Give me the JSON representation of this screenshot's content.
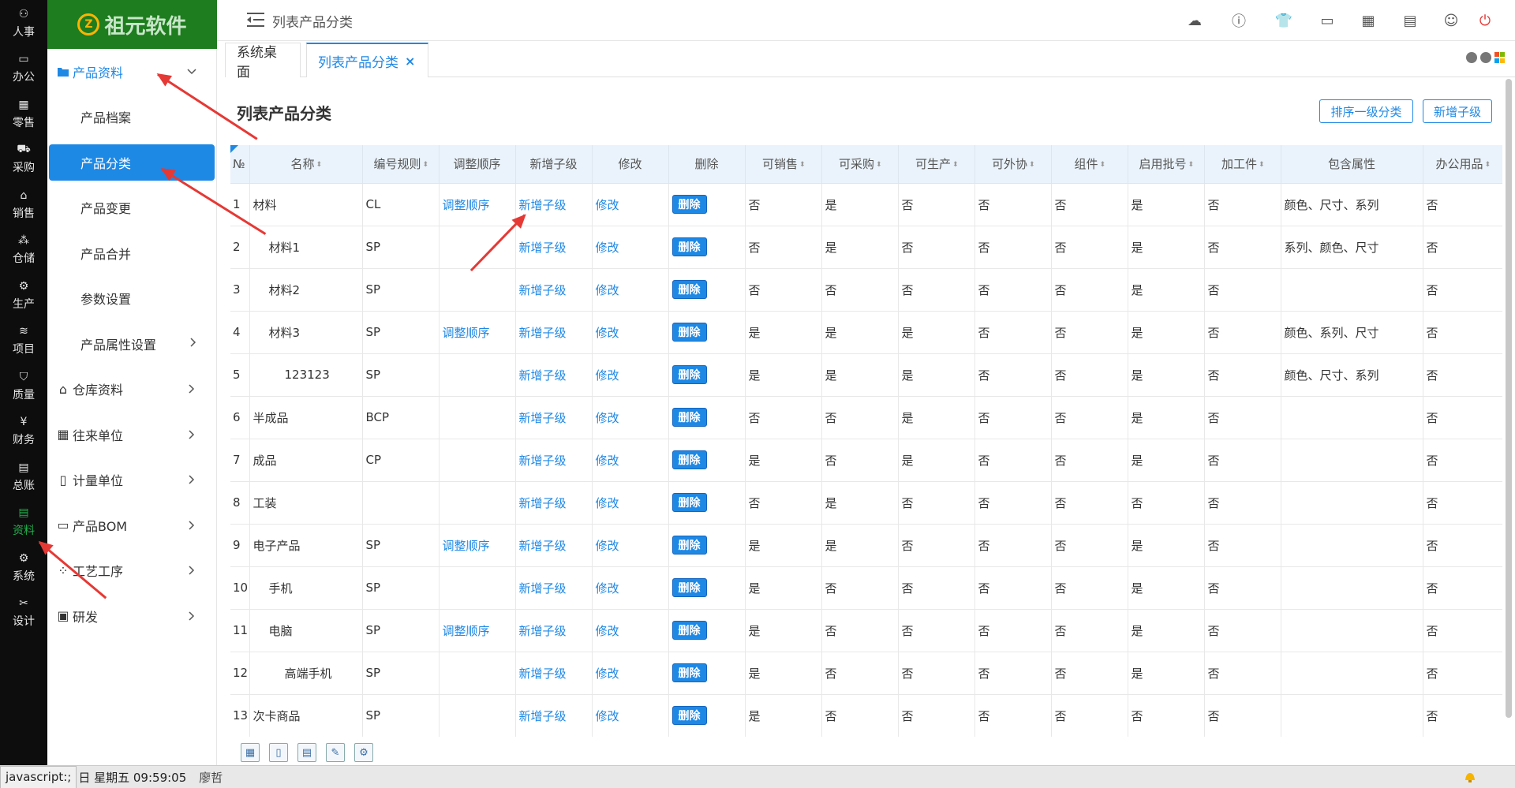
{
  "app": {
    "logo_text": "祖元软件",
    "rail": [
      {
        "label": "人事",
        "icon": "people-icon"
      },
      {
        "label": "办公",
        "icon": "monitor-icon"
      },
      {
        "label": "零售",
        "icon": "store-icon"
      },
      {
        "label": "采购",
        "icon": "truck-icon"
      },
      {
        "label": "销售",
        "icon": "shop-icon"
      },
      {
        "label": "仓储",
        "icon": "boxes-icon"
      },
      {
        "label": "生产",
        "icon": "factory-icon"
      },
      {
        "label": "项目",
        "icon": "layers-icon"
      },
      {
        "label": "质量",
        "icon": "shield-icon"
      },
      {
        "label": "财务",
        "icon": "yen-icon"
      },
      {
        "label": "总账",
        "icon": "ledger-icon"
      },
      {
        "label": "资料",
        "icon": "document-icon"
      },
      {
        "label": "系统",
        "icon": "gear-icon"
      },
      {
        "label": "设计",
        "icon": "tools-icon"
      }
    ],
    "rail_active_index": 11
  },
  "sidebar": {
    "group_open": {
      "label": "产品资料",
      "icon": "folder-icon"
    },
    "sub_items": [
      "产品档案",
      "产品分类",
      "产品变更",
      "产品合并",
      "参数设置",
      "产品属性设置"
    ],
    "active_sub_index": 1,
    "groups": [
      {
        "label": "仓库资料",
        "icon": "warehouse-icon"
      },
      {
        "label": "往来单位",
        "icon": "building-icon"
      },
      {
        "label": "计量单位",
        "icon": "ruler-icon"
      },
      {
        "label": "产品BOM",
        "icon": "bom-icon"
      },
      {
        "label": "工艺工序",
        "icon": "process-icon"
      },
      {
        "label": "研发",
        "icon": "research-icon"
      }
    ]
  },
  "topbar": {
    "crumb": "列表产品分类",
    "icons": [
      "cloud-icon",
      "help-icon",
      "shirt-icon",
      "window-icon",
      "apps-icon",
      "calendar-icon",
      "user-card-icon",
      "power-icon"
    ]
  },
  "tabs": [
    {
      "label": "系统桌面"
    },
    {
      "label": "列表产品分类",
      "close": "×"
    }
  ],
  "page": {
    "title": "列表产品分类",
    "sort_button": "排序一级分类",
    "add_child_button": "新增子级"
  },
  "table": {
    "headers": [
      "№",
      "名称",
      "编号规则",
      "调整顺序",
      "新增子级",
      "修改",
      "删除",
      "可销售",
      "可采购",
      "可生产",
      "可外协",
      "组件",
      "启用批号",
      "加工件",
      "包含属性",
      "办公用品"
    ],
    "sortable": [
      false,
      true,
      true,
      false,
      false,
      false,
      false,
      true,
      true,
      true,
      true,
      true,
      true,
      true,
      false,
      true
    ],
    "rows": [
      {
        "no": "1",
        "name": "材料",
        "indent": 0,
        "code": "CL",
        "adjust": "调整顺序",
        "add": "新增子级",
        "edit": "修改",
        "del": "删除",
        "sale": "否",
        "purchase": "是",
        "produce": "否",
        "outsource": "否",
        "component": "否",
        "batch": "是",
        "processed": "否",
        "attrs": "颜色、尺寸、系列",
        "office": "否"
      },
      {
        "no": "2",
        "name": "材料1",
        "indent": 1,
        "code": "SP",
        "adjust": "",
        "add": "新增子级",
        "edit": "修改",
        "del": "删除",
        "sale": "否",
        "purchase": "是",
        "produce": "否",
        "outsource": "否",
        "component": "否",
        "batch": "是",
        "processed": "否",
        "attrs": "系列、颜色、尺寸",
        "office": "否"
      },
      {
        "no": "3",
        "name": "材料2",
        "indent": 1,
        "code": "SP",
        "adjust": "",
        "add": "新增子级",
        "edit": "修改",
        "del": "删除",
        "sale": "否",
        "purchase": "否",
        "produce": "否",
        "outsource": "否",
        "component": "否",
        "batch": "是",
        "processed": "否",
        "attrs": "",
        "office": "否"
      },
      {
        "no": "4",
        "name": "材料3",
        "indent": 1,
        "code": "SP",
        "adjust": "调整顺序",
        "add": "新增子级",
        "edit": "修改",
        "del": "删除",
        "sale": "是",
        "purchase": "是",
        "produce": "是",
        "outsource": "否",
        "component": "否",
        "batch": "是",
        "processed": "否",
        "attrs": "颜色、系列、尺寸",
        "office": "否"
      },
      {
        "no": "5",
        "name": "123123",
        "indent": 2,
        "code": "SP",
        "adjust": "",
        "add": "新增子级",
        "edit": "修改",
        "del": "删除",
        "sale": "是",
        "purchase": "是",
        "produce": "是",
        "outsource": "否",
        "component": "否",
        "batch": "是",
        "processed": "否",
        "attrs": "颜色、尺寸、系列",
        "office": "否"
      },
      {
        "no": "6",
        "name": "半成品",
        "indent": 0,
        "code": "BCP",
        "adjust": "",
        "add": "新增子级",
        "edit": "修改",
        "del": "删除",
        "sale": "否",
        "purchase": "否",
        "produce": "是",
        "outsource": "否",
        "component": "否",
        "batch": "是",
        "processed": "否",
        "attrs": "",
        "office": "否"
      },
      {
        "no": "7",
        "name": "成品",
        "indent": 0,
        "code": "CP",
        "adjust": "",
        "add": "新增子级",
        "edit": "修改",
        "del": "删除",
        "sale": "是",
        "purchase": "否",
        "produce": "是",
        "outsource": "否",
        "component": "否",
        "batch": "是",
        "processed": "否",
        "attrs": "",
        "office": "否"
      },
      {
        "no": "8",
        "name": "工装",
        "indent": 0,
        "code": "",
        "adjust": "",
        "add": "新增子级",
        "edit": "修改",
        "del": "删除",
        "sale": "否",
        "purchase": "是",
        "produce": "否",
        "outsource": "否",
        "component": "否",
        "batch": "否",
        "processed": "否",
        "attrs": "",
        "office": "否"
      },
      {
        "no": "9",
        "name": "电子产品",
        "indent": 0,
        "code": "SP",
        "adjust": "调整顺序",
        "add": "新增子级",
        "edit": "修改",
        "del": "删除",
        "sale": "是",
        "purchase": "是",
        "produce": "否",
        "outsource": "否",
        "component": "否",
        "batch": "是",
        "processed": "否",
        "attrs": "",
        "office": "否"
      },
      {
        "no": "10",
        "name": "手机",
        "indent": 1,
        "code": "SP",
        "adjust": "",
        "add": "新增子级",
        "edit": "修改",
        "del": "删除",
        "sale": "是",
        "purchase": "否",
        "produce": "否",
        "outsource": "否",
        "component": "否",
        "batch": "是",
        "processed": "否",
        "attrs": "",
        "office": "否"
      },
      {
        "no": "11",
        "name": "电脑",
        "indent": 1,
        "code": "SP",
        "adjust": "调整顺序",
        "add": "新增子级",
        "edit": "修改",
        "del": "删除",
        "sale": "是",
        "purchase": "否",
        "produce": "否",
        "outsource": "否",
        "component": "否",
        "batch": "是",
        "processed": "否",
        "attrs": "",
        "office": "否"
      },
      {
        "no": "12",
        "name": "高端手机",
        "indent": 2,
        "code": "SP",
        "adjust": "",
        "add": "新增子级",
        "edit": "修改",
        "del": "删除",
        "sale": "是",
        "purchase": "否",
        "produce": "否",
        "outsource": "否",
        "component": "否",
        "batch": "是",
        "processed": "否",
        "attrs": "",
        "office": "否"
      },
      {
        "no": "13",
        "name": "次卡商品",
        "indent": 0,
        "code": "SP",
        "adjust": "",
        "add": "新增子级",
        "edit": "修改",
        "del": "删除",
        "sale": "是",
        "purchase": "否",
        "produce": "否",
        "outsource": "否",
        "component": "否",
        "batch": "否",
        "processed": "否",
        "attrs": "",
        "office": "否"
      }
    ]
  },
  "footer_tools": [
    "grid-icon",
    "page-icon",
    "table-icon",
    "edit-icon",
    "settings-icon"
  ],
  "status": {
    "js": "javascript:;",
    "date": "日 星期五 09:59:05",
    "user": "廖哲",
    "bell_icon": "bell-icon"
  },
  "colors": {
    "accent": "#1e88e5",
    "logo_bg": "#1e7d1e",
    "rail_bg": "#0d0d0d",
    "annotation": "#e53935",
    "active_rail": "#22b14c"
  }
}
